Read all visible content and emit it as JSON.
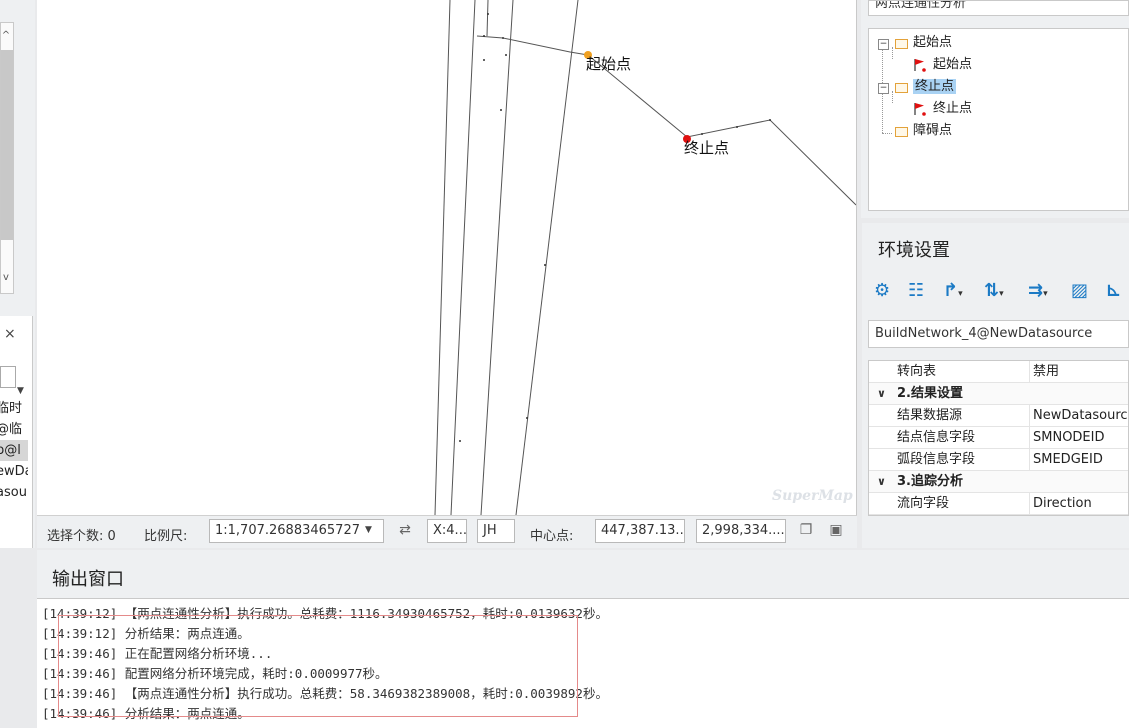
{
  "left_panel": {
    "scroll_up": "^",
    "scroll_down": "v",
    "close": "×",
    "list_items": [
      "临时",
      "@临",
      "p@l",
      "ewDa",
      "asour"
    ]
  },
  "map": {
    "labels": {
      "start": "起始点",
      "end": "终止点"
    },
    "watermark": "SuperMap",
    "colors": {
      "start_point": "#f0a020",
      "end_point": "#e01010",
      "lines": "#555555"
    }
  },
  "statusbar": {
    "selected_count_label": "选择个数: 0",
    "scale_label": "比例尺:",
    "scale_value": "1:1,707.26883465727",
    "coord_x": "X:4...",
    "coord_mode": "JH",
    "center_label": "中心点:",
    "center_x": "447,387.13...",
    "center_y": "2,998,334...."
  },
  "analysis_panel": {
    "title": "两点连通性分析",
    "tree": {
      "start_group": "起始点",
      "start_item": "起始点",
      "end_group": "终止点",
      "end_item": "终止点",
      "barrier_group": "障碍点"
    }
  },
  "env_panel": {
    "title": "环境设置",
    "toolbar_icons": [
      "gear-icon",
      "grid-icon",
      "arrow-branch-icon",
      "weight-icon",
      "direction-icon",
      "raster-icon",
      "path-icon"
    ],
    "dataset": "BuildNetwork_4@NewDatasource",
    "properties": {
      "turn_table": {
        "key": "转向表",
        "value": "禁用"
      },
      "result_settings": "2.结果设置",
      "result_datasource": {
        "key": "结果数据源",
        "value": "NewDatasource"
      },
      "node_id_field": {
        "key": "结点信息字段",
        "value": "SMNODEID"
      },
      "edge_id_field": {
        "key": "弧段信息字段",
        "value": "SMEDGEID"
      },
      "trace_analysis": "3.追踪分析",
      "direction_field": {
        "key": "流向字段",
        "value": "Direction"
      }
    }
  },
  "output": {
    "title": "输出窗口",
    "lines": [
      "[14:39:12] 【两点连通性分析】执行成功。总耗费：1116.34930465752，耗时:0.0139632秒。",
      "[14:39:12] 分析结果：两点连通。",
      "[14:39:46] 正在配置网络分析环境...",
      "[14:39:46] 配置网络分析环境完成，耗时:0.0009977秒。",
      "[14:39:46] 【两点连通性分析】执行成功。总耗费：58.3469382389008，耗时:0.0039892秒。",
      "[14:39:46] 分析结果：两点连通。"
    ]
  }
}
